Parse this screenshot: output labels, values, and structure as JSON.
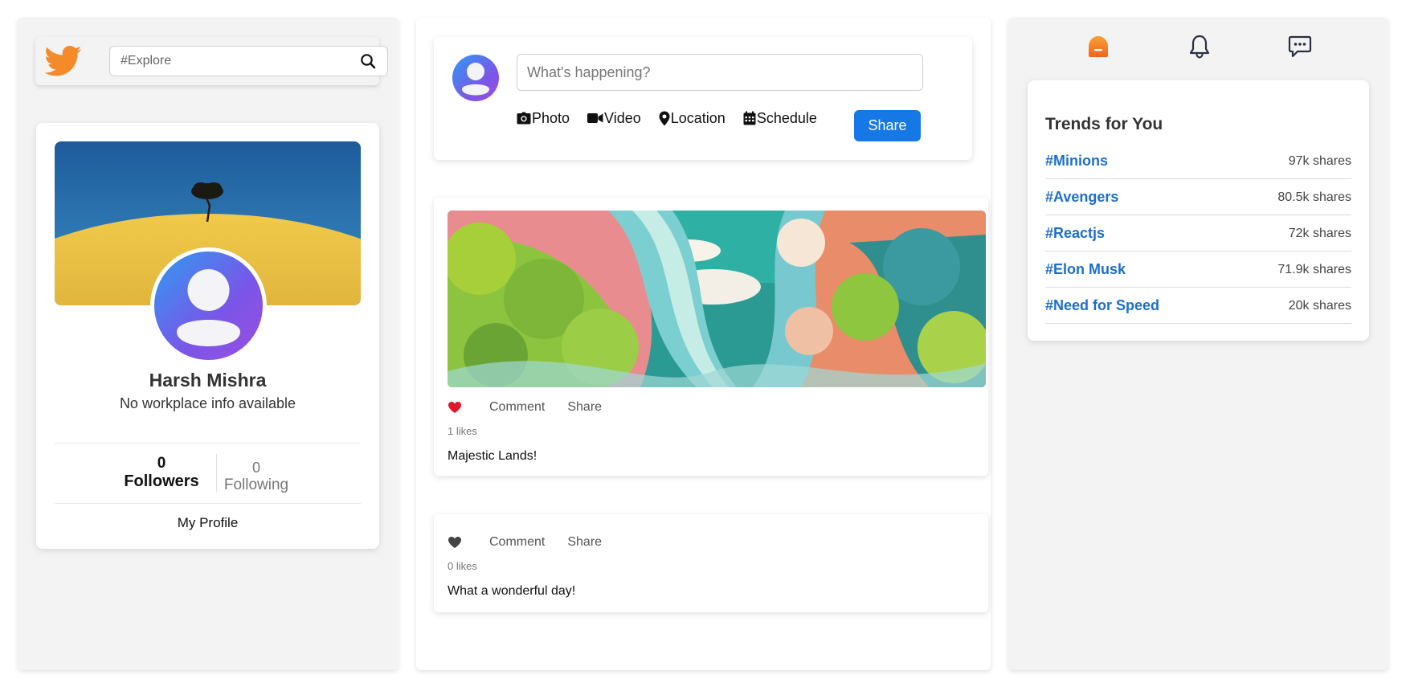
{
  "search": {
    "placeholder": "#Explore"
  },
  "profile": {
    "name": "Harsh Mishra",
    "workplace": "No workplace info available",
    "followers_count": "0",
    "followers_label": "Followers",
    "following_count": "0",
    "following_label": "Following",
    "my_profile_label": "My Profile"
  },
  "composer": {
    "placeholder": "What's happening?",
    "actions": [
      {
        "label": "Photo",
        "icon": "camera-icon"
      },
      {
        "label": "Video",
        "icon": "video-icon"
      },
      {
        "label": "Location",
        "icon": "location-pin-icon"
      },
      {
        "label": "Schedule",
        "icon": "calendar-icon"
      }
    ],
    "share_label": "Share"
  },
  "posts": [
    {
      "liked": true,
      "comment_label": "Comment",
      "share_label": "Share",
      "likes": "1 likes",
      "caption": "Majestic Lands!"
    },
    {
      "liked": false,
      "comment_label": "Comment",
      "share_label": "Share",
      "likes": "0 likes",
      "caption": "What a wonderful day!"
    }
  ],
  "nav": {
    "icons": [
      "home-icon",
      "bell-icon",
      "message-icon"
    ]
  },
  "trends": {
    "title": "Trends for You",
    "items": [
      {
        "tag": "#Minions",
        "shares": "97k shares"
      },
      {
        "tag": "#Avengers",
        "shares": "80.5k shares"
      },
      {
        "tag": "#Reactjs",
        "shares": "72k shares"
      },
      {
        "tag": "#Elon Musk",
        "shares": "71.9k shares"
      },
      {
        "tag": "#Need for Speed",
        "shares": "20k shares"
      }
    ]
  },
  "colors": {
    "accent": "#1677e6",
    "link": "#1d6fc9",
    "logo": "#f58a2b",
    "like": "#e0182d"
  }
}
